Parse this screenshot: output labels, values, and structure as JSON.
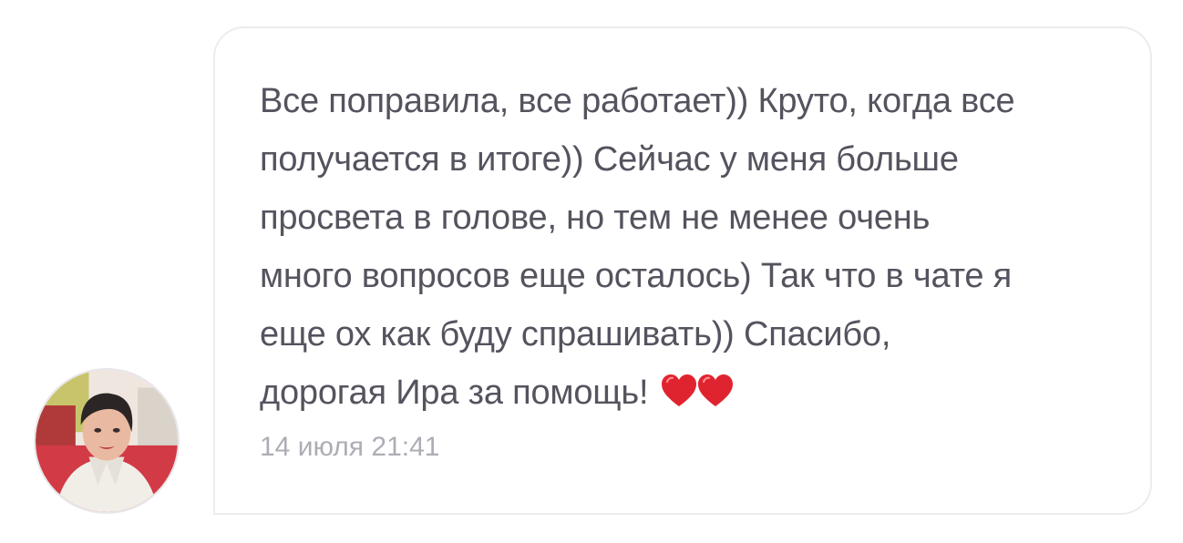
{
  "message": {
    "lines": [
      "Все поправила, все работает)) Круто, когда все",
      "получается в итоге)) Сейчас у меня больше",
      "просвета в голове, но тем не менее очень",
      "много вопросов еще осталось) Так что в чате я",
      "еще ох как буду спрашивать)) Спасибо,",
      "дорогая Ира за помощь!"
    ],
    "emoji": [
      "heart-icon",
      "heart-icon"
    ],
    "timestamp": "14 июля 21:41"
  },
  "colors": {
    "text": "#55535e",
    "timestamp": "#aeacb4",
    "bubble_border": "#ececef",
    "heart": "#e0242f"
  }
}
